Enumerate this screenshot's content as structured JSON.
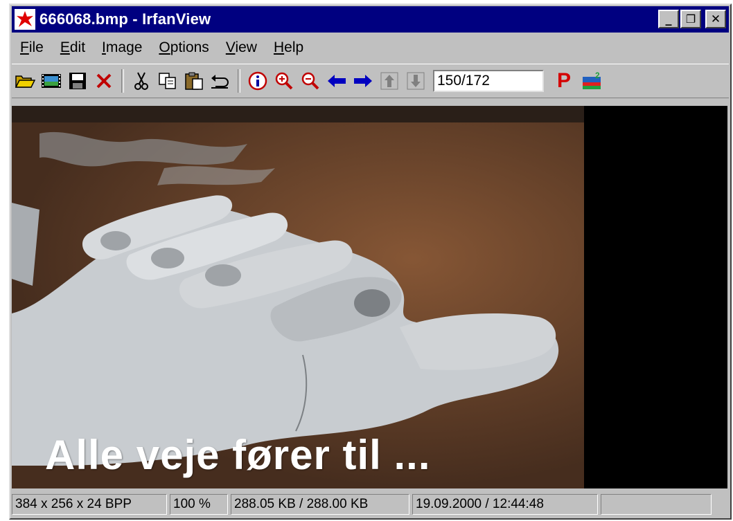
{
  "window": {
    "title": "666068.bmp - IrfanView"
  },
  "caption_buttons": {
    "minimize": "_",
    "restore": "❐",
    "close": "✕"
  },
  "menu": [
    {
      "label": "File",
      "accel": "F",
      "rest": "ile"
    },
    {
      "label": "Edit",
      "accel": "E",
      "rest": "dit"
    },
    {
      "label": "Image",
      "accel": "I",
      "rest": "mage"
    },
    {
      "label": "Options",
      "accel": "O",
      "rest": "ptions"
    },
    {
      "label": "View",
      "accel": "V",
      "rest": "iew"
    },
    {
      "label": "Help",
      "accel": "H",
      "rest": "elp"
    }
  ],
  "toolbar": {
    "icons": [
      "open-folder-icon",
      "slideshow-icon",
      "save-icon",
      "delete-icon",
      "cut-icon",
      "copy-icon",
      "paste-icon",
      "undo-icon",
      "info-icon",
      "zoom-in-icon",
      "zoom-out-icon",
      "previous-icon",
      "next-icon",
      "first-page-icon",
      "last-page-icon",
      "print-icon",
      "color-icon"
    ],
    "page_counter": "150/172",
    "print_label": "P"
  },
  "image": {
    "caption": "Alle veje fører til ...",
    "background_color": "#000000"
  },
  "status": {
    "dimensions": "384 x 256 x 24 BPP",
    "zoom": "100 %",
    "size": "288.05 KB / 288.00 KB",
    "datetime": "19.09.2000 / 12:44:48",
    "extra": ""
  },
  "colors": {
    "titlebar": "#000080",
    "chrome": "#c0c0c0",
    "delete_red": "#c00000",
    "arrow_blue": "#0000c0"
  }
}
